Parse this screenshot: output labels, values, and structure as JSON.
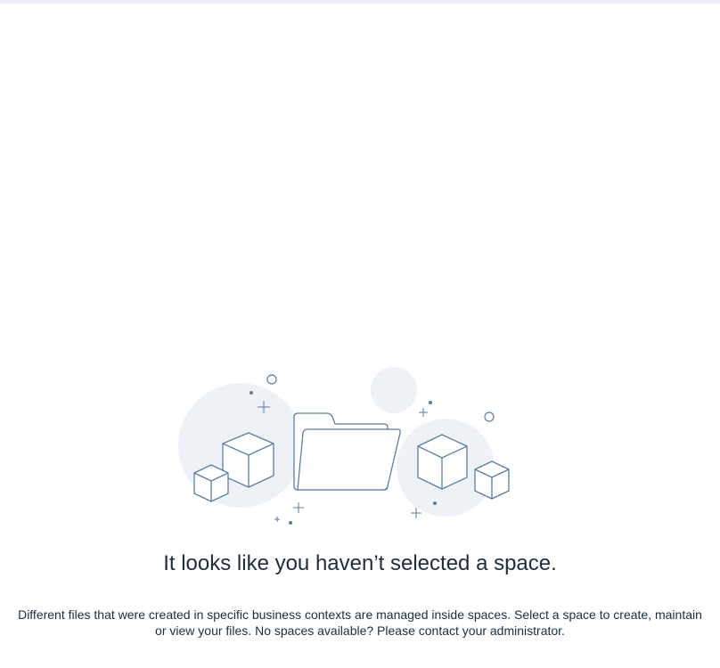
{
  "empty_state": {
    "illustration_icon": "folder-with-boxes-illustration",
    "title": "It looks like you haven’t selected a space.",
    "description": "Different files that were created in specific business contexts are managed inside spaces. Select a space to create, maintain or view your files. No spaces available? Please contact your administrator."
  },
  "colors": {
    "line": "#5b7ea3",
    "bubble": "#eef2f7",
    "text": "#1d2d3e",
    "top_strip": "#eef2f6"
  }
}
